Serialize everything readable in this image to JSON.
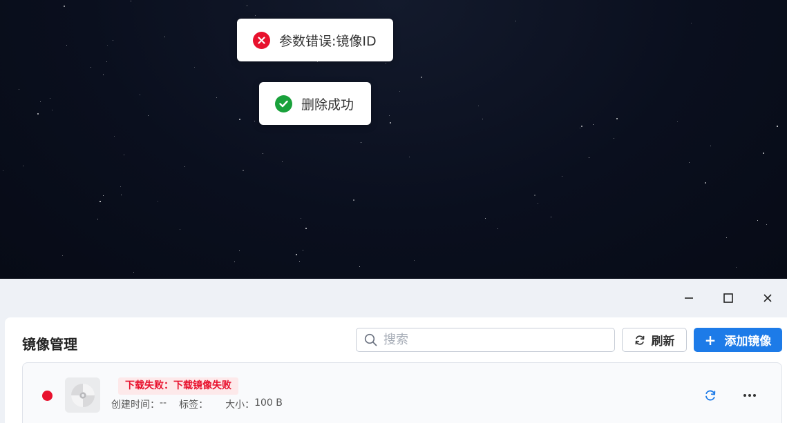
{
  "toasts": {
    "error": {
      "text": "参数错误:镜像ID",
      "icon": "error-circle-icon",
      "color": "#e8112d"
    },
    "success": {
      "text": "删除成功",
      "icon": "check-circle-icon",
      "color": "#19a13b"
    }
  },
  "window_controls": [
    "minimize-icon",
    "maximize-icon",
    "close-icon"
  ],
  "header": {
    "title": "镜像管理",
    "search_placeholder": "搜索",
    "search_value": "",
    "refresh_label": "刷新",
    "add_label": "添加镜像",
    "accent": "#1d7be8"
  },
  "images": [
    {
      "status_color": "#e8112d",
      "icon": "disc-icon",
      "badge": "下载失败：下载镜像失败",
      "created_label": "创建时间：",
      "created_value": "--",
      "tags_label": "标签：",
      "tags_value": "",
      "size_label": "大小：",
      "size_value": "100 B"
    }
  ]
}
